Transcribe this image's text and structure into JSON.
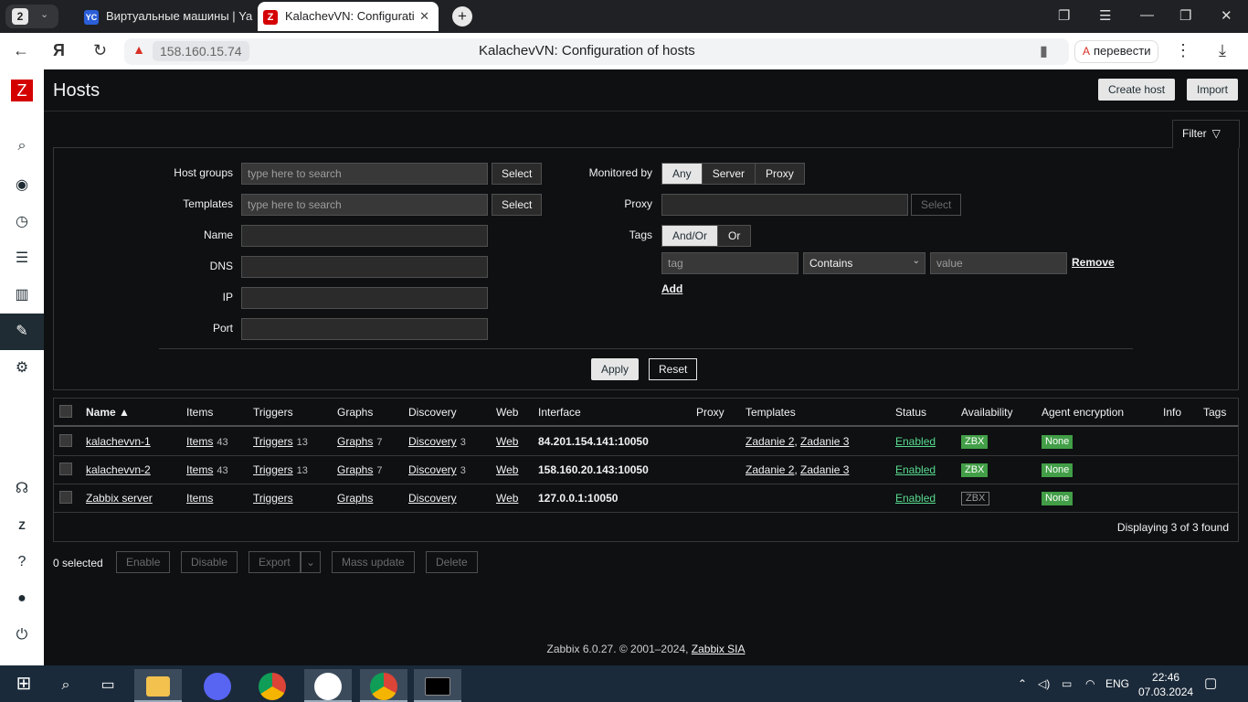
{
  "browser": {
    "tab_count": "2",
    "tabs": [
      {
        "label": "Виртуальные машины | Ya",
        "favicon": "YC"
      },
      {
        "label": "KalachevVN: Configurati",
        "favicon": "Z"
      }
    ],
    "url_host": "158.160.15.74",
    "page_title": "KalachevVN: Configuration of hosts",
    "translate_label": "перевести"
  },
  "sidebar": {
    "logo": "Z",
    "items": [
      "search-icon",
      "monitoring-eye-icon",
      "services-clock-icon",
      "inventory-list-icon",
      "reports-chart-icon",
      "data-collection-wrench-icon",
      "alerts-gear-icon"
    ],
    "bottom_items": [
      "support-headset-icon",
      "zabbix-share-icon",
      "help-icon",
      "user-settings-icon",
      "sign-out-icon"
    ]
  },
  "header": {
    "title": "Hosts",
    "create_host": "Create host",
    "import": "Import"
  },
  "filter": {
    "tab_label": "Filter",
    "host_groups_label": "Host groups",
    "host_groups_placeholder": "type here to search",
    "templates_label": "Templates",
    "templates_placeholder": "type here to search",
    "select_label": "Select",
    "name_label": "Name",
    "dns_label": "DNS",
    "ip_label": "IP",
    "port_label": "Port",
    "monitored_by_label": "Monitored by",
    "monitored_by_options": [
      "Any",
      "Server",
      "Proxy"
    ],
    "monitored_by_selected": "Any",
    "proxy_label": "Proxy",
    "tags_label": "Tags",
    "tags_operator_options": [
      "And/Or",
      "Or"
    ],
    "tags_operator_selected": "And/Or",
    "tag_placeholder": "tag",
    "tag_condition": "Contains",
    "value_placeholder": "value",
    "remove_label": "Remove",
    "add_label": "Add",
    "apply_label": "Apply",
    "reset_label": "Reset"
  },
  "table": {
    "headers": [
      "Name ▲",
      "Items",
      "Triggers",
      "Graphs",
      "Discovery",
      "Web",
      "Interface",
      "Proxy",
      "Templates",
      "Status",
      "Availability",
      "Agent encryption",
      "Info",
      "Tags"
    ],
    "rows": [
      {
        "name": "kalachevvn-1",
        "items": "Items",
        "items_count": "43",
        "triggers": "Triggers",
        "triggers_count": "13",
        "graphs": "Graphs",
        "graphs_count": "7",
        "discovery": "Discovery",
        "discovery_count": "3",
        "web": "Web",
        "interface": "84.201.154.141:10050",
        "template1": "Zadanie 2",
        "template2": "Zadanie 3",
        "status": "Enabled",
        "availability": "ZBX",
        "encryption": "None"
      },
      {
        "name": "kalachevvn-2",
        "items": "Items",
        "items_count": "43",
        "triggers": "Triggers",
        "triggers_count": "13",
        "graphs": "Graphs",
        "graphs_count": "7",
        "discovery": "Discovery",
        "discovery_count": "3",
        "web": "Web",
        "interface": "158.160.20.143:10050",
        "template1": "Zadanie 2",
        "template2": "Zadanie 3",
        "status": "Enabled",
        "availability": "ZBX",
        "encryption": "None"
      },
      {
        "name": "Zabbix server",
        "items": "Items",
        "triggers": "Triggers",
        "graphs": "Graphs",
        "discovery": "Discovery",
        "web": "Web",
        "interface": "127.0.0.1:10050",
        "status": "Enabled",
        "availability": "ZBX",
        "encryption": "None"
      }
    ],
    "footer": "Displaying 3 of 3 found"
  },
  "actions": {
    "selected": "0 selected",
    "enable": "Enable",
    "disable": "Disable",
    "export": "Export",
    "mass_update": "Mass update",
    "delete": "Delete"
  },
  "footer": {
    "copyright": "Zabbix 6.0.27. © 2001–2024, ",
    "company": "Zabbix SIA"
  },
  "taskbar": {
    "language": "ENG",
    "time": "22:46",
    "date": "07.03.2024"
  },
  "colors": {
    "zabbix_red": "#d40000",
    "status_green": "#59db8f",
    "badge_green": "#429e47"
  }
}
